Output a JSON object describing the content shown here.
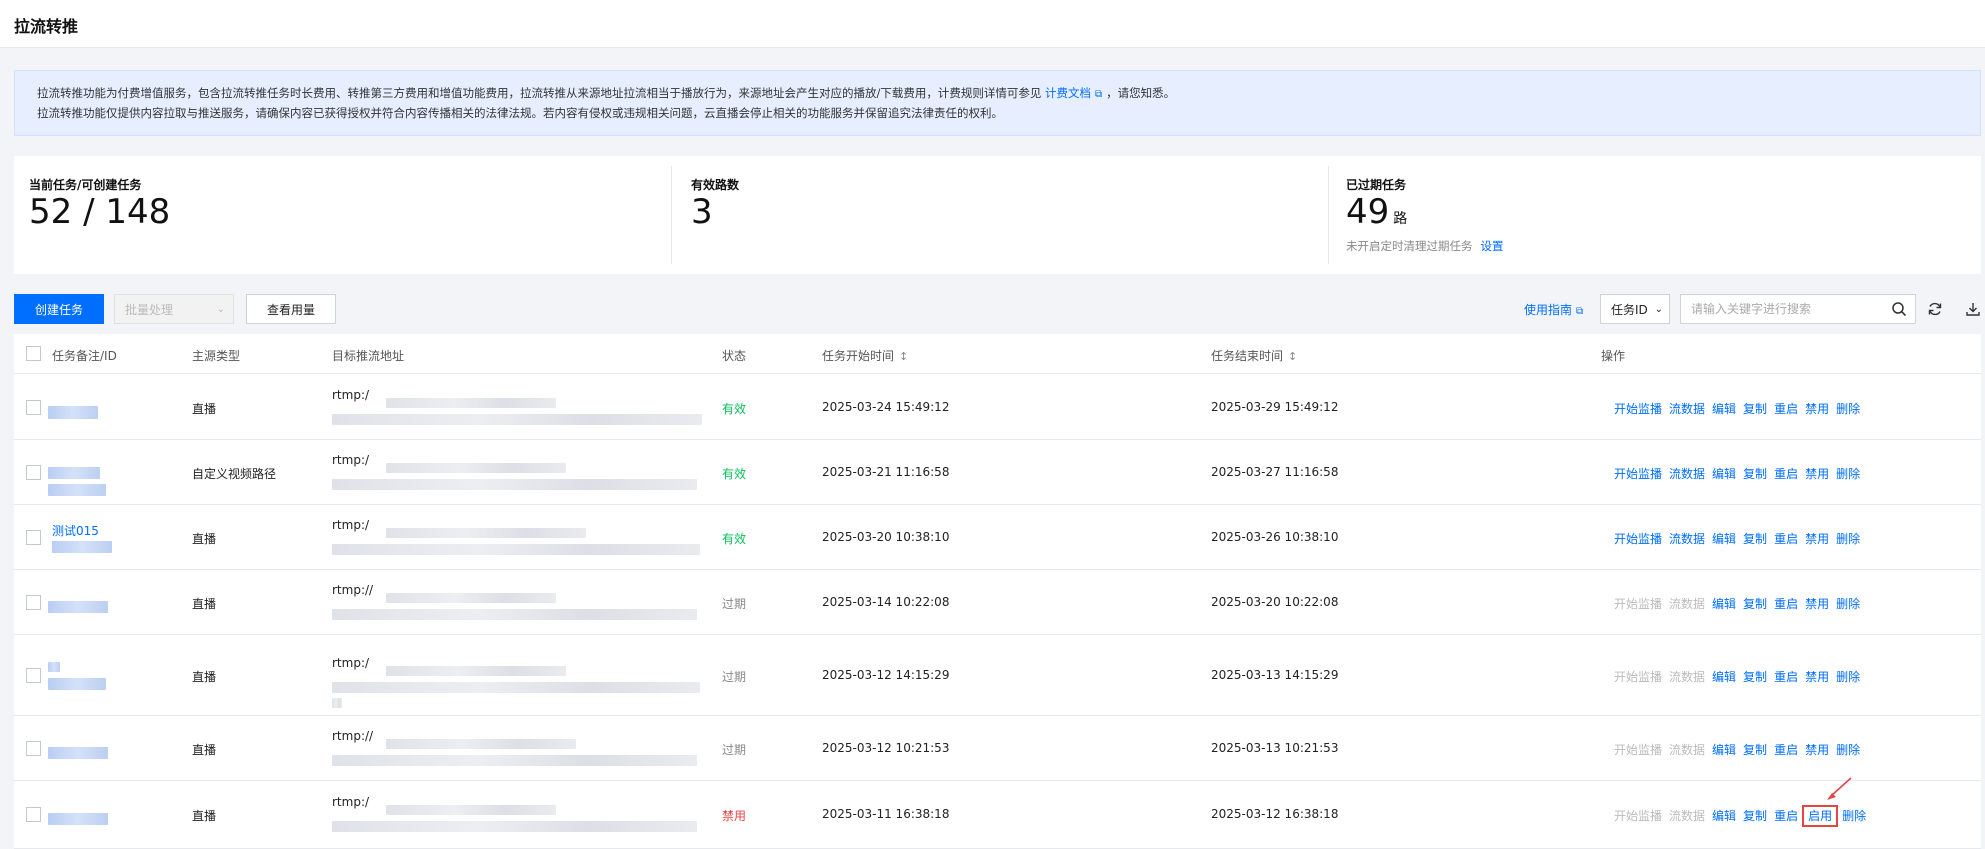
{
  "page": {
    "title": "拉流转推"
  },
  "notice": {
    "line1_prefix": "拉流转推功能为付费增值服务，包含拉流转推任务时长费用、转推第三方费用和增值功能费用，拉流转推从来源地址拉流相当于播放行为，来源地址会产生对应的播放/下载费用，计费规则详情可参见",
    "line1_link": "计费文档",
    "line1_suffix": "，请您知悉。",
    "line2": "拉流转推功能仅提供内容拉取与推送服务，请确保内容已获得授权并符合内容传播相关的法律法规。若内容有侵权或违规相关问题，云直播会停止相关的功能服务并保留追究法律责任的权利。"
  },
  "stats": {
    "current": {
      "label": "当前任务/可创建任务",
      "value": "52 / 148"
    },
    "valid": {
      "label": "有效路数",
      "value": "3"
    },
    "expired": {
      "label": "已过期任务",
      "value": "49",
      "unit": "路",
      "sub": "未开启定时清理过期任务",
      "link": "设置"
    }
  },
  "toolbar": {
    "create": "创建任务",
    "batch": "批量处理",
    "usage": "查看用量",
    "guide": "使用指南",
    "filter": "任务ID",
    "search_placeholder": "请输入关键字进行搜索"
  },
  "columns": {
    "id": "任务备注/ID",
    "source": "主源类型",
    "target": "目标推流地址",
    "status": "状态",
    "start": "任务开始时间",
    "end": "任务结束时间",
    "ops": "操作"
  },
  "operations": [
    "开始监播",
    "流数据",
    "编辑",
    "复制",
    "重启",
    "禁用",
    "删除"
  ],
  "rows": [
    {
      "note": "",
      "source": "直播",
      "target": "rtmp:/",
      "status": "有效",
      "start": "2025-03-24 15:49:12",
      "end": "2025-03-29 15:49:12",
      "toggle": "禁用"
    },
    {
      "note": "",
      "source": "自定义视频路径",
      "target": "rtmp:/",
      "status": "有效",
      "start": "2025-03-21 11:16:58",
      "end": "2025-03-27 11:16:58",
      "toggle": "禁用"
    },
    {
      "note": "测试015",
      "source": "直播",
      "target": "rtmp:/",
      "status": "有效",
      "start": "2025-03-20 10:38:10",
      "end": "2025-03-26 10:38:10",
      "toggle": "禁用"
    },
    {
      "note": "",
      "source": "直播",
      "target": "rtmp://",
      "status": "过期",
      "start": "2025-03-14 10:22:08",
      "end": "2025-03-20 10:22:08",
      "toggle": "禁用"
    },
    {
      "note": "",
      "source": "直播",
      "target": "rtmp:/",
      "status": "过期",
      "start": "2025-03-12 14:15:29",
      "end": "2025-03-13 14:15:29",
      "toggle": "禁用"
    },
    {
      "note": "",
      "source": "直播",
      "target": "rtmp://",
      "status": "过期",
      "start": "2025-03-12 10:21:53",
      "end": "2025-03-13 10:21:53",
      "toggle": "禁用"
    },
    {
      "note": "",
      "source": "直播",
      "target": "rtmp:/",
      "status": "禁用",
      "start": "2025-03-11 16:38:18",
      "end": "2025-03-12 16:38:18",
      "toggle": "启用"
    }
  ]
}
